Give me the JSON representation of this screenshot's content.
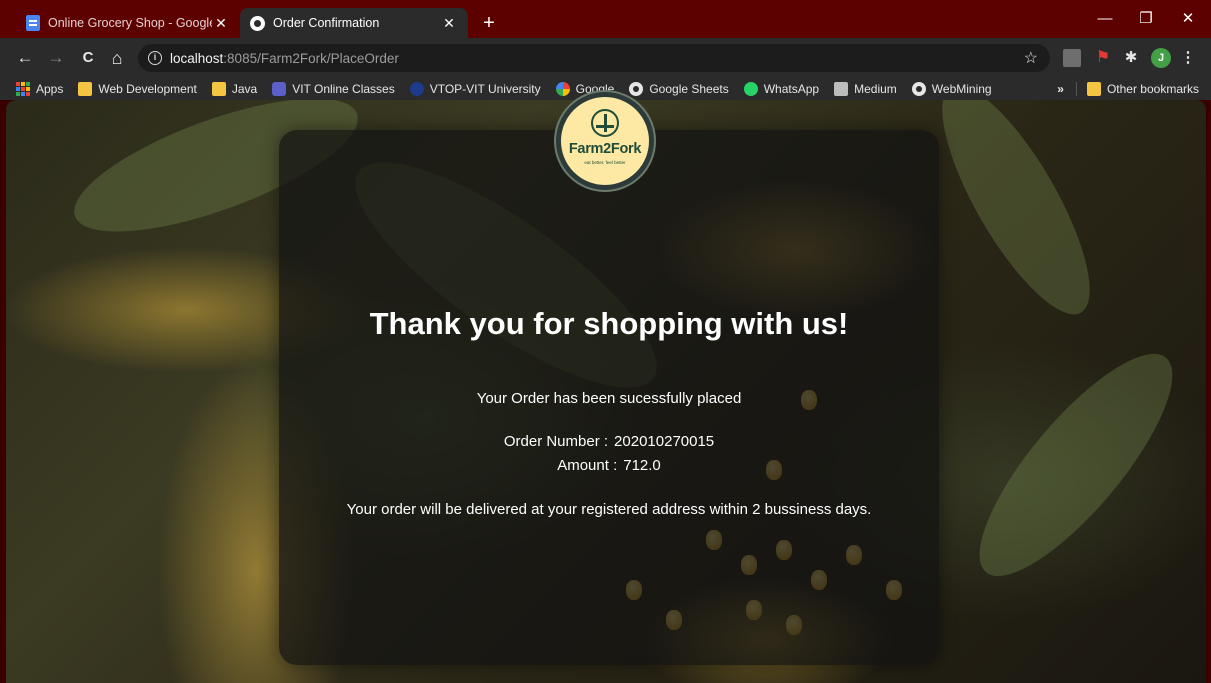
{
  "browser": {
    "tabs": [
      {
        "title": "Online Grocery Shop - Google D",
        "active": false,
        "icon": "google-docs-icon"
      },
      {
        "title": "Order Confirmation",
        "active": true,
        "icon": "globe-icon"
      }
    ],
    "close_glyph": "✕",
    "new_tab_glyph": "+",
    "window_controls": {
      "minimize": "—",
      "restore": "❐",
      "close": "✕"
    },
    "nav": {
      "back": "←",
      "forward": "→",
      "reload": "C",
      "home": "⌂"
    },
    "address": {
      "host": "localhost",
      "rest": ":8085/Farm2Fork/PlaceOrder"
    },
    "star_glyph": "☆",
    "profile_initial": "J",
    "menu_glyph": "⋮",
    "bookmarks": [
      {
        "label": "Apps",
        "icon": "apps-icon"
      },
      {
        "label": "Web Development",
        "icon": "folder-icon"
      },
      {
        "label": "Java",
        "icon": "folder-icon"
      },
      {
        "label": "VIT Online Classes",
        "icon": "teams-icon"
      },
      {
        "label": "VTOP-VIT University",
        "icon": "vtop-icon"
      },
      {
        "label": "Google",
        "icon": "google-icon"
      },
      {
        "label": "Google Sheets",
        "icon": "globe-icon"
      },
      {
        "label": "WhatsApp",
        "icon": "whatsapp-icon"
      },
      {
        "label": "Medium",
        "icon": "medium-icon"
      },
      {
        "label": "WebMining",
        "icon": "globe-icon"
      }
    ],
    "overflow_glyph": "»",
    "other_bookmarks": "Other bookmarks"
  },
  "page": {
    "logo": {
      "text": "Farm2Fork",
      "tagline": "eat better, feel better"
    },
    "headline": "Thank you for shopping with us!",
    "status": "Your Order has been sucessfully placed",
    "order_number_label": "Order Number :",
    "order_number": "202010270015",
    "amount_label": "Amount :",
    "amount": "712.0",
    "delivery_note": "Your order will be delivered at your registered address within 2 bussiness days."
  },
  "colors": {
    "tabstrip": "#5c0000",
    "toolbar": "#2b2b2b",
    "card": "rgba(18,18,18,0.72)",
    "logo_bg": "#fde9a4",
    "logo_ink": "#1f4d3a"
  }
}
